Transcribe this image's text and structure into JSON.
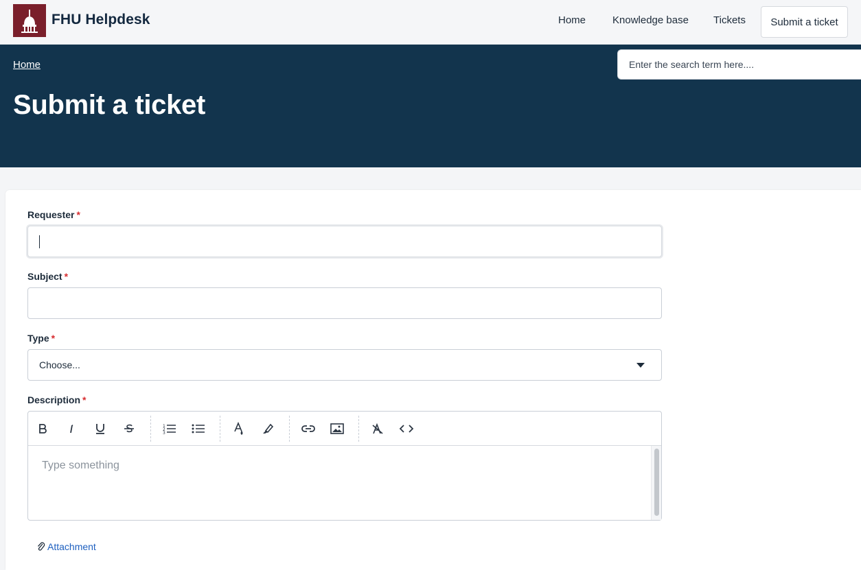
{
  "header": {
    "brand": "FHU Helpdesk",
    "nav": {
      "home": "Home",
      "knowledge_base": "Knowledge base",
      "tickets": "Tickets",
      "submit": "Submit a ticket"
    }
  },
  "hero": {
    "breadcrumb": "Home",
    "title": "Submit a ticket",
    "search_placeholder": "Enter the search term here...."
  },
  "form": {
    "requester": {
      "label": "Requester",
      "required": "*",
      "value": ""
    },
    "subject": {
      "label": "Subject",
      "required": "*",
      "value": ""
    },
    "type": {
      "label": "Type",
      "required": "*",
      "selected": "Choose..."
    },
    "description": {
      "label": "Description",
      "required": "*",
      "placeholder": "Type something",
      "toolbar": [
        "bold-icon",
        "italic-icon",
        "underline-icon",
        "strikethrough-icon",
        "ordered-list-icon",
        "bulleted-list-icon",
        "font-color-icon",
        "highlight-icon",
        "link-icon",
        "image-icon",
        "clear-format-icon",
        "code-icon"
      ]
    },
    "attachment": "Attachment"
  },
  "colors": {
    "hero_bg": "#12344d",
    "logo_bg": "#7a1f2b",
    "required": "#d72d30",
    "link": "#1d5fbf"
  }
}
